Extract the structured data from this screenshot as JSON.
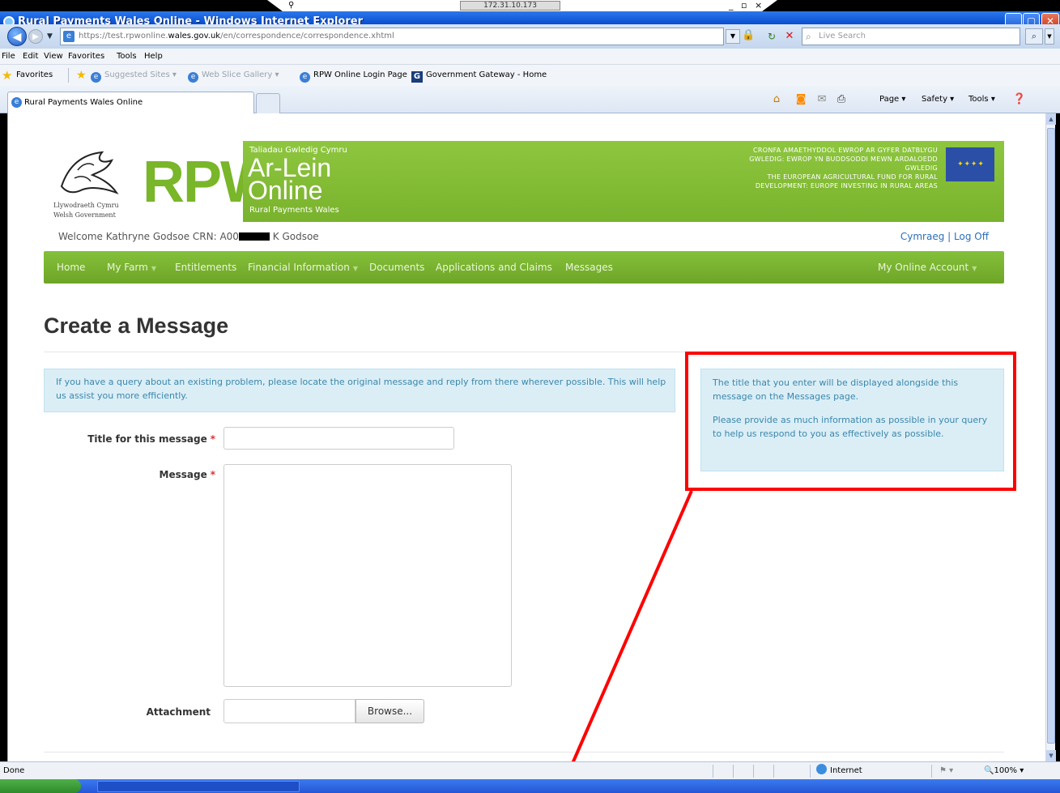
{
  "remote": {
    "pin_icon": "pin-icon",
    "ip": "172.31.10.173",
    "controls": "_  ̅ x"
  },
  "browser": {
    "window_title": "Rural Payments Wales Online - Windows Internet Explorer",
    "address": {
      "url_prefix": "https://test.rpwonline.",
      "url_domain": "wales.gov.uk",
      "url_suffix": "/en/correspondence/correspondence.xhtml"
    },
    "search_placeholder": "Live Search",
    "menu": [
      "File",
      "Edit",
      "View",
      "Favorites",
      "Tools",
      "Help"
    ],
    "favorites": {
      "label": "Favorites",
      "links": [
        "Suggested Sites ▾",
        "Web Slice Gallery ▾",
        "RPW Online Login Page",
        "Government Gateway - Home"
      ]
    },
    "tab_label": "Rural Payments Wales Online",
    "commands": {
      "page": "Page ▾",
      "safety": "Safety ▾",
      "tools": "Tools ▾"
    },
    "status": {
      "text": "Done",
      "zone": "Internet",
      "zoom": "100%"
    }
  },
  "site": {
    "gov_welsh": "Llywodraeth Cymru",
    "gov_english": "Welsh Government",
    "logo_text": "RPW",
    "header_welsh_small": "Taliadau Gwledig Cymru",
    "header_arlein": "Ar-Lein",
    "header_online": "Online",
    "header_english_small": "Rural Payments Wales",
    "fund_welsh": "CRONFA AMAETHYDDOL EWROP AR GYFER DATBLYGU GWLEDIG: EWROP YN BUDDSODDI MEWN ARDALOEDD GWLEDIG",
    "fund_english": "THE EUROPEAN AGRICULTURAL FUND FOR RURAL DEVELOPMENT: EUROPE INVESTING IN RURAL AREAS",
    "welcome_prefix": "Welcome Kathryne Godsoe CRN: A00",
    "welcome_suffix": " K Godsoe",
    "lang_link": "Cymraeg",
    "lang_sep": " | ",
    "logoff_link": "Log Off",
    "nav": {
      "home": "Home",
      "my_farm": "My Farm",
      "entitlements": "Entitlements",
      "financial": "Financial Information",
      "documents": "Documents",
      "applications": "Applications and Claims",
      "messages": "Messages",
      "account": "My Online Account"
    }
  },
  "page": {
    "title": "Create a Message",
    "info": "If you have a query about an existing problem, please locate the original message and reply from there wherever possible. This will help us assist you more efficiently.",
    "help_p1": "The title that you enter will be displayed alongside this message on the Messages page.",
    "help_p2": "Please provide as much information as possible in your query to help us respond to you as effectively as possible.",
    "form": {
      "title_label": "Title for this message",
      "message_label": "Message",
      "attachment_label": "Attachment",
      "required_mark": "*",
      "title_value": "",
      "message_value": "",
      "browse_label": "Browse..."
    }
  },
  "colors": {
    "rpw_green": "#79b62a",
    "nav_green": "#6ea527",
    "info_text": "#3a87ad",
    "info_bg": "#dbeef6",
    "annotation_red": "#ff0000"
  }
}
